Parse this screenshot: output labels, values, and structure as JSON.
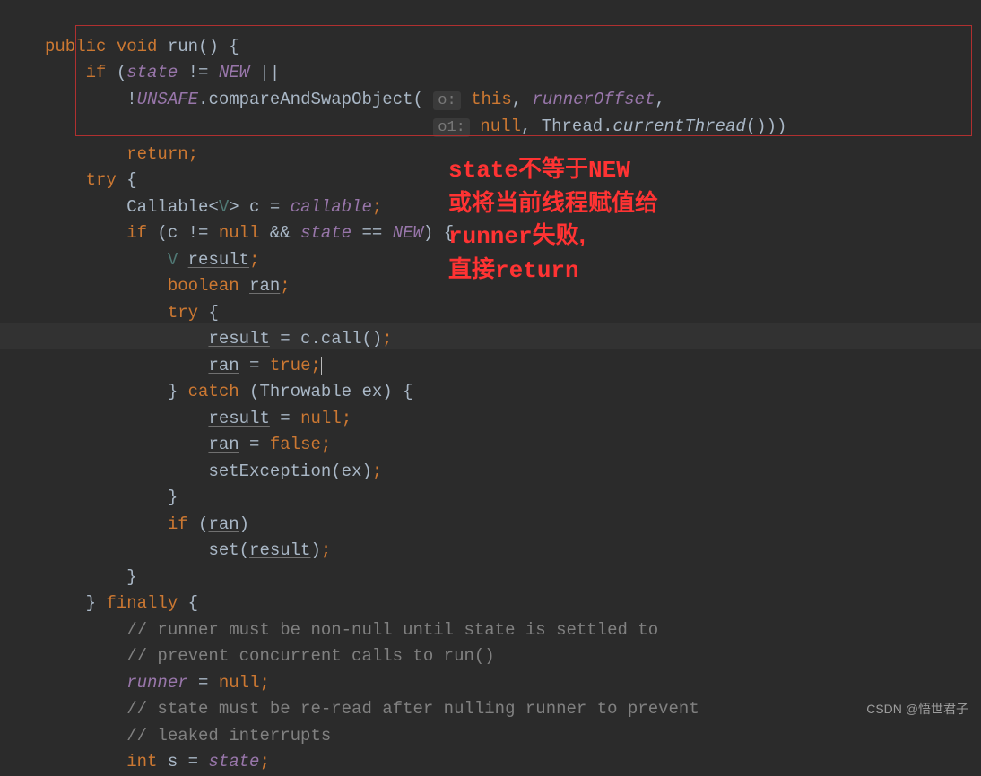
{
  "code": {
    "l1": {
      "kw1": "public",
      "kw2": "void",
      "name": "run",
      "brace": "() {"
    },
    "l2": {
      "kw": "if",
      "p1": " (",
      "var": "state",
      " t": " != ",
      "c": "NEW",
      "end": " ||"
    },
    "l3": {
      "bang": "!",
      "f": "UNSAFE",
      "dot": ".compareAndSwapObject( ",
      "h1": "o:",
      "sp1": " ",
      "kw": "this",
      "c1": ", ",
      "f2": "runnerOffset",
      "c2": ","
    },
    "l4": {
      "h2": "o1:",
      "sp": " ",
      "kw": "null",
      "c": ", Thread.",
      "m": "currentThread",
      "end": "()))"
    },
    "l5": {
      "kw": "return",
      "sc": ";"
    },
    "l6": {
      "kw": "try",
      "b": " {"
    },
    "l7": {
      "t1": "Callable<",
      "tp": "V",
      "t2": "> c = ",
      "f": "callable",
      "sc": ";"
    },
    "l8": {
      "kw": "if",
      "p": " (c != ",
      "n": "null",
      "a": " && ",
      "v": "state",
      "eq": " == ",
      "c": "NEW",
      "end": ") {"
    },
    "l9": {
      "tp": "V",
      "sp": " ",
      "u": "result",
      "sc": ";"
    },
    "l10": {
      "kw": "boolean",
      "sp": " ",
      "u": "ran",
      "sc": ";"
    },
    "l11": {
      "kw": "try",
      "b": " {"
    },
    "l12": {
      "u": "result",
      "eq": " = c.call()",
      "sc": ";"
    },
    "l13": {
      "u": "ran",
      "eq": " = ",
      "kw": "true",
      "sc": ";"
    },
    "l14": {
      "b": "} ",
      "kw": "catch",
      "p": " (Throwable ex) {"
    },
    "l15": {
      "u": "result",
      "eq": " = ",
      "kw": "null",
      "sc": ";"
    },
    "l16": {
      "u": "ran",
      "eq": " = ",
      "kw": "false",
      "sc": ";"
    },
    "l17": {
      "m": "setException(ex)",
      "sc": ";"
    },
    "l18": {
      "b": "}"
    },
    "l19": {
      "kw": "if",
      "p": " (",
      "u": "ran",
      "e": ")"
    },
    "l20": {
      "m": "set(",
      "u": "result",
      "e": ")",
      "sc": ";"
    },
    "l21": {
      "b": "}"
    },
    "l22": {
      "b": "} ",
      "kw": "finally",
      "e": " {"
    },
    "l23": {
      "c": "// runner must be non-null until state is settled to"
    },
    "l24": {
      "c": "// prevent concurrent calls to run()"
    },
    "l25": {
      "f": "runner",
      "eq": " = ",
      "kw": "null",
      "sc": ";"
    },
    "l26": {
      "c": "// state must be re-read after nulling runner to prevent"
    },
    "l27": {
      "c": "// leaked interrupts"
    },
    "l28": {
      "kw": "int",
      "t": " s = ",
      "f": "state",
      "sc": ";"
    }
  },
  "annotation": {
    "line1_a": "state",
    "line1_b": "不等于",
    "line1_c": "NEW",
    "line2": "或将当前线程赋值给",
    "line3_a": "runner",
    "line3_b": "失败,",
    "line4_a": "直接",
    "line4_b": "return"
  },
  "watermark": "CSDN @悟世君子"
}
